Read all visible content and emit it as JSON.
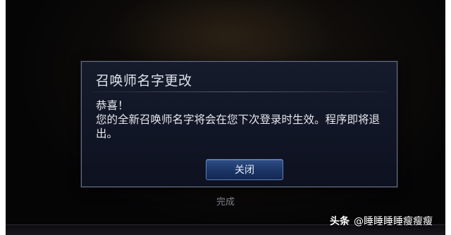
{
  "dialog": {
    "title": "召唤师名字更改",
    "message_line1": "恭喜！",
    "message_line2": "您的全新召唤师名字将会在您下次登录时生效。程序即将退出。",
    "close_label": "关闭"
  },
  "footer": {
    "done_label": "完成"
  },
  "watermark": {
    "brand": "头条",
    "handle": "@睡睡睡睡瘦瘦瘦"
  },
  "colors": {
    "dialog_bg": "#131829",
    "button_bg": "#1b3566",
    "button_border": "#5e7fb8"
  }
}
